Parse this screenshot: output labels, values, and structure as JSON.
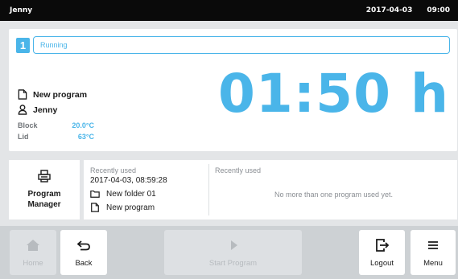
{
  "header": {
    "user": "Jenny",
    "date": "2017-04-03",
    "time": "09:00"
  },
  "run": {
    "slot_number": "1",
    "status": "Running",
    "program_name": "New program",
    "user_name": "Jenny",
    "block_label": "Block",
    "block_value": "20.0°C",
    "lid_label": "Lid",
    "lid_value": "63°C",
    "remaining_time": "01:50 h"
  },
  "program_manager": {
    "label_line1": "Program",
    "label_line2": "Manager"
  },
  "recent_left": {
    "heading": "Recently used",
    "timestamp": "2017-04-03, 08:59:28",
    "folder": "New folder 01",
    "program": "New program"
  },
  "recent_right": {
    "heading": "Recently used",
    "message": "No more than one program used yet."
  },
  "nav": {
    "home": "Home",
    "back": "Back",
    "start": "Start Program",
    "logout": "Logout",
    "menu": "Menu"
  },
  "colors": {
    "accent": "#4ab5e9",
    "topbar": "#0a0a0a",
    "disabled_text": "#b7bbbf"
  },
  "icons": {
    "program": "document-icon",
    "user": "user-icon",
    "program_manager": "printer-icon",
    "folder": "folder-icon",
    "home": "home-icon",
    "back": "back-arrow-icon",
    "start": "play-icon",
    "logout": "logout-icon",
    "menu": "hamburger-menu-icon"
  }
}
